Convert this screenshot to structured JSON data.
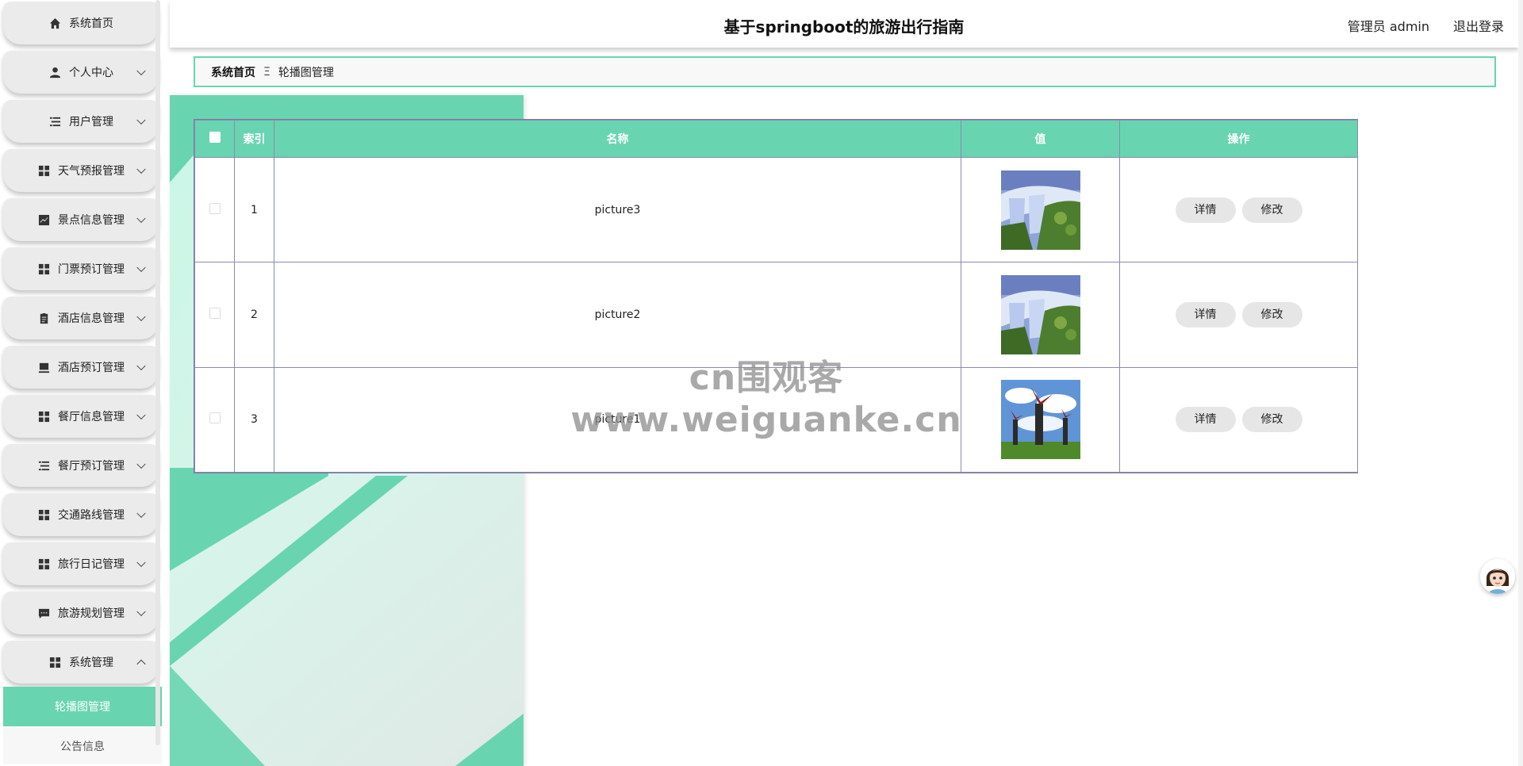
{
  "header": {
    "title": "基于springboot的旅游出行指南",
    "user": "管理员 admin",
    "logout": "退出登录"
  },
  "sidebar": {
    "items": [
      {
        "label": "系统首页",
        "icon": "home-icon",
        "expandable": false
      },
      {
        "label": "个人中心",
        "icon": "person-icon",
        "expandable": true
      },
      {
        "label": "用户管理",
        "icon": "list-icon",
        "expandable": true
      },
      {
        "label": "天气预报管理",
        "icon": "grid-icon",
        "expandable": true
      },
      {
        "label": "景点信息管理",
        "icon": "chart-icon",
        "expandable": true
      },
      {
        "label": "门票预订管理",
        "icon": "grid-icon",
        "expandable": true
      },
      {
        "label": "酒店信息管理",
        "icon": "clipboard-icon",
        "expandable": true
      },
      {
        "label": "酒店预订管理",
        "icon": "inbox-icon",
        "expandable": true
      },
      {
        "label": "餐厅信息管理",
        "icon": "grid-icon",
        "expandable": true
      },
      {
        "label": "餐厅预订管理",
        "icon": "list-icon",
        "expandable": true
      },
      {
        "label": "交通路线管理",
        "icon": "grid-icon",
        "expandable": true
      },
      {
        "label": "旅行日记管理",
        "icon": "grid-icon",
        "expandable": true
      },
      {
        "label": "旅游规划管理",
        "icon": "message-icon",
        "expandable": true
      },
      {
        "label": "系统管理",
        "icon": "grid-icon",
        "expandable": true,
        "expanded": true
      }
    ],
    "submenu_active": "轮播图管理",
    "submenu_next": "公告信息"
  },
  "breadcrumb": {
    "home": "系统首页",
    "separator": "Ξ",
    "current": "轮播图管理"
  },
  "table": {
    "columns": [
      "索引",
      "名称",
      "值",
      "操作"
    ],
    "rows": [
      {
        "index": "1",
        "name": "picture3",
        "image": "waterfall-image"
      },
      {
        "index": "2",
        "name": "picture2",
        "image": "waterfall-image"
      },
      {
        "index": "3",
        "name": "picture1",
        "image": "windmill-image"
      }
    ],
    "detail_label": "详情",
    "edit_label": "修改"
  },
  "watermark": "cn围观客www.weiguanke.cn",
  "colors": {
    "accent": "#68d5b0",
    "menu_bg": "#ebebeb",
    "table_border": "#8a8ab0"
  }
}
